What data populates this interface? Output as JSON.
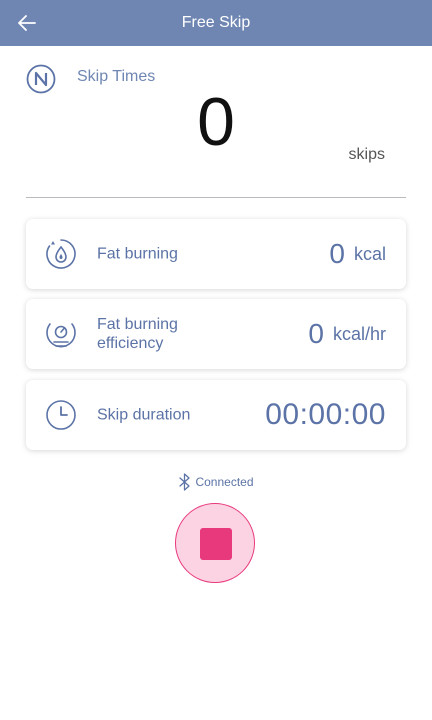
{
  "header": {
    "title": "Free Skip",
    "back_icon": "arrow-left-icon"
  },
  "counter": {
    "label": "Skip Times",
    "value": "0",
    "unit": "skips",
    "icon": "n-badge-icon"
  },
  "metrics": [
    {
      "label": "Fat burning",
      "value": "0",
      "unit": "kcal",
      "icon": "flame-drop-icon"
    },
    {
      "label": "Fat burning efficiency",
      "value": "0",
      "unit": "kcal/hr",
      "icon": "scale-gauge-icon"
    },
    {
      "label": "Skip duration",
      "value": "00:00:00",
      "icon": "clock-icon"
    }
  ],
  "connection": {
    "status": "Connected",
    "icon": "bluetooth-icon"
  },
  "stop_button": {
    "icon": "stop-icon"
  },
  "colors": {
    "header": "#6f86b3",
    "accent_text": "#5b73a6",
    "stop": "#e8397d",
    "stop_bg": "#fcd3e3"
  }
}
